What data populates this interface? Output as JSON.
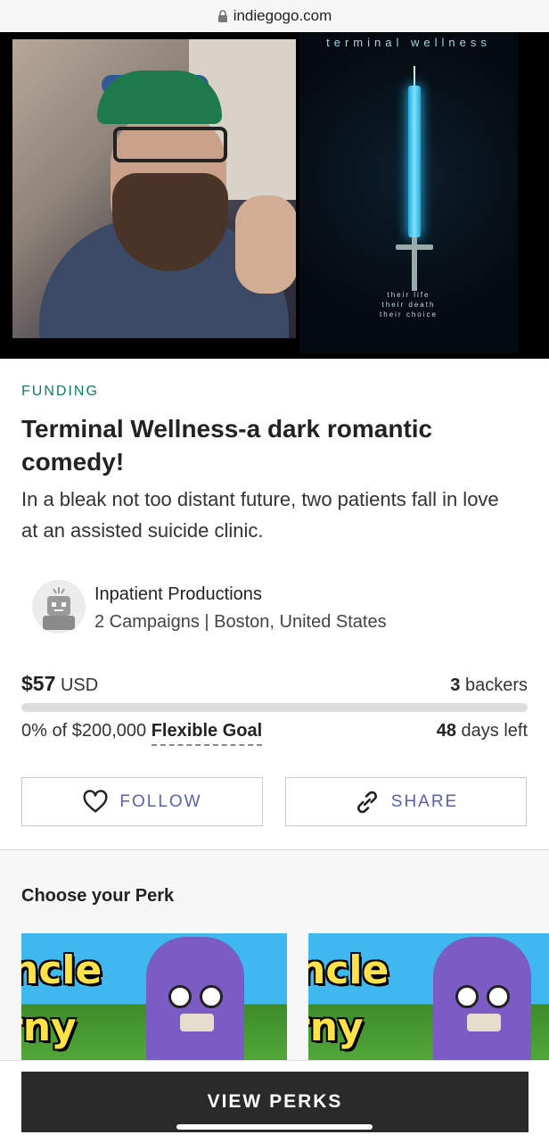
{
  "browser": {
    "url": "indiegogo.com",
    "lock_icon": "lock-icon"
  },
  "hero": {
    "poster_title": "terminal wellness",
    "poster_tagline": [
      "their life",
      "their death",
      "their choice"
    ]
  },
  "campaign": {
    "category": "FUNDING",
    "title": "Terminal Wellness-a dark romantic comedy!",
    "tagline": "In a bleak not too distant future, two patients fall in love at an assisted suicide clinic."
  },
  "owner": {
    "name": "Inpatient Productions",
    "meta": "2 Campaigns | Boston, United States"
  },
  "funding": {
    "raised_amount": "$57",
    "currency": "USD",
    "backers_count": "3",
    "backers_label": "backers",
    "percent": "0%",
    "goal_text": "of $200,000",
    "goal_type": "Flexible Goal",
    "days_count": "48",
    "days_label": "days left",
    "progress_fraction": 0.0,
    "accent_color": "#0e7d5e"
  },
  "actions": {
    "follow_label": "FOLLOW",
    "follow_icon": "heart-icon",
    "share_label": "SHARE",
    "share_icon": "link-icon"
  },
  "perks": {
    "section_title": "Choose your Perk",
    "cards": [
      {
        "line1": "ncle",
        "line2": "rny"
      },
      {
        "line1": "ncle",
        "line2": "rny"
      }
    ]
  },
  "footer": {
    "view_perks_label": "VIEW PERKS"
  }
}
